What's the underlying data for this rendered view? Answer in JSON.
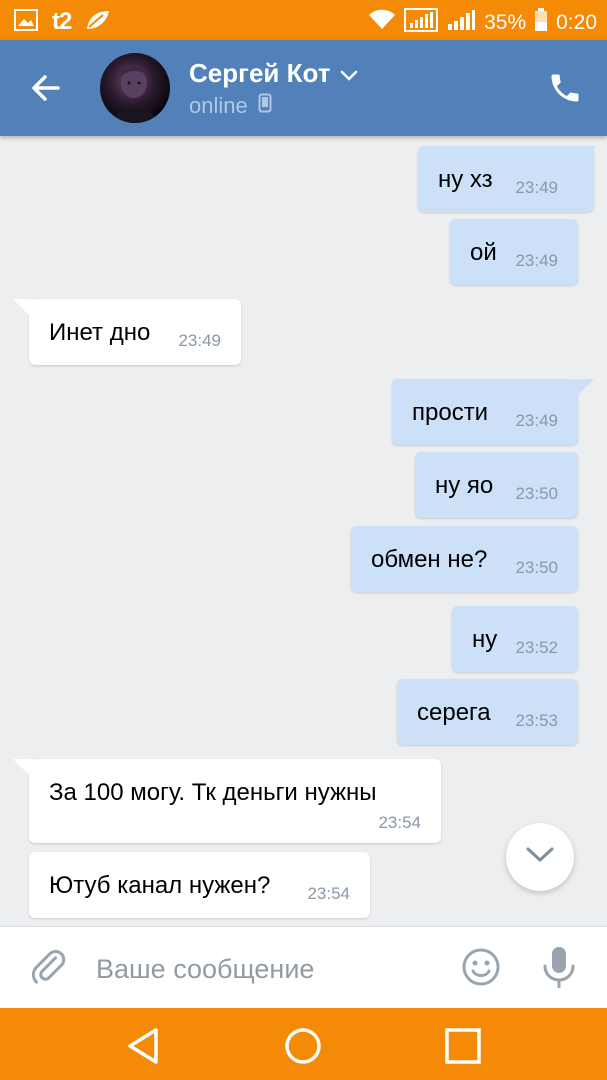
{
  "status_bar": {
    "carrier": "t2",
    "battery": "35%",
    "time": "0:20",
    "icons": [
      "image-icon",
      "leaf-icon",
      "wifi-icon",
      "signal-icon",
      "signal-icon",
      "battery-icon"
    ]
  },
  "header": {
    "contact_name": "Сергей Кот",
    "status": "online",
    "icons": [
      "back-arrow-icon",
      "chevron-down-icon",
      "mobile-phone-icon",
      "phone-call-icon"
    ]
  },
  "messages": [
    {
      "dir": "out",
      "text": "ну хз",
      "time": "23:49"
    },
    {
      "dir": "out",
      "text": "ой",
      "time": "23:49"
    },
    {
      "dir": "in",
      "text": "Инет дно",
      "time": "23:49"
    },
    {
      "dir": "out",
      "text": "прости",
      "time": "23:49"
    },
    {
      "dir": "out",
      "text": "ну яо",
      "time": "23:50"
    },
    {
      "dir": "out",
      "text": "обмен не?",
      "time": "23:50"
    },
    {
      "dir": "out",
      "text": "ну",
      "time": "23:52"
    },
    {
      "dir": "out",
      "text": "серега",
      "time": "23:53"
    },
    {
      "dir": "in",
      "text": "За 100 могу. Тк деньги нужны",
      "time": "23:54"
    },
    {
      "dir": "in",
      "text": "Ютуб канал нужен?",
      "time": "23:54"
    }
  ],
  "composer": {
    "placeholder": "Ваше сообщение"
  },
  "colors": {
    "status_bar": "#f58a07",
    "header": "#5181b8",
    "outgoing_bubble": "#cce0f7",
    "incoming_bubble": "#ffffff",
    "chat_background": "#edeef0"
  }
}
